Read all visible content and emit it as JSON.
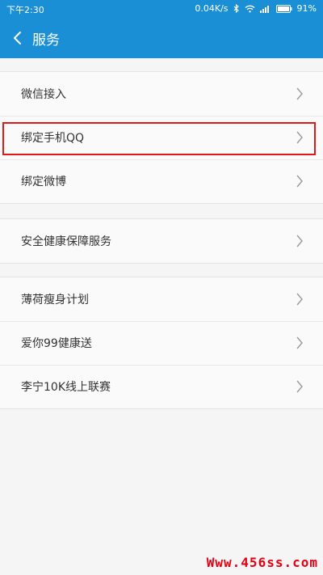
{
  "status_bar": {
    "time": "下午2:30",
    "network_speed": "0.04K/s",
    "battery": "91%"
  },
  "app_bar": {
    "title": "服务"
  },
  "groups": [
    {
      "items": [
        {
          "label": "微信接入"
        },
        {
          "label": "绑定手机QQ"
        },
        {
          "label": "绑定微博"
        }
      ]
    },
    {
      "items": [
        {
          "label": "安全健康保障服务"
        }
      ]
    },
    {
      "items": [
        {
          "label": "薄荷瘦身计划"
        },
        {
          "label": "爱你99健康送"
        },
        {
          "label": "李宁10K线上联赛"
        }
      ]
    }
  ],
  "watermark": "Www.456ss.com",
  "colors": {
    "header": "#1a8fd6",
    "highlight": "#e01818",
    "watermark": "#e60012"
  }
}
